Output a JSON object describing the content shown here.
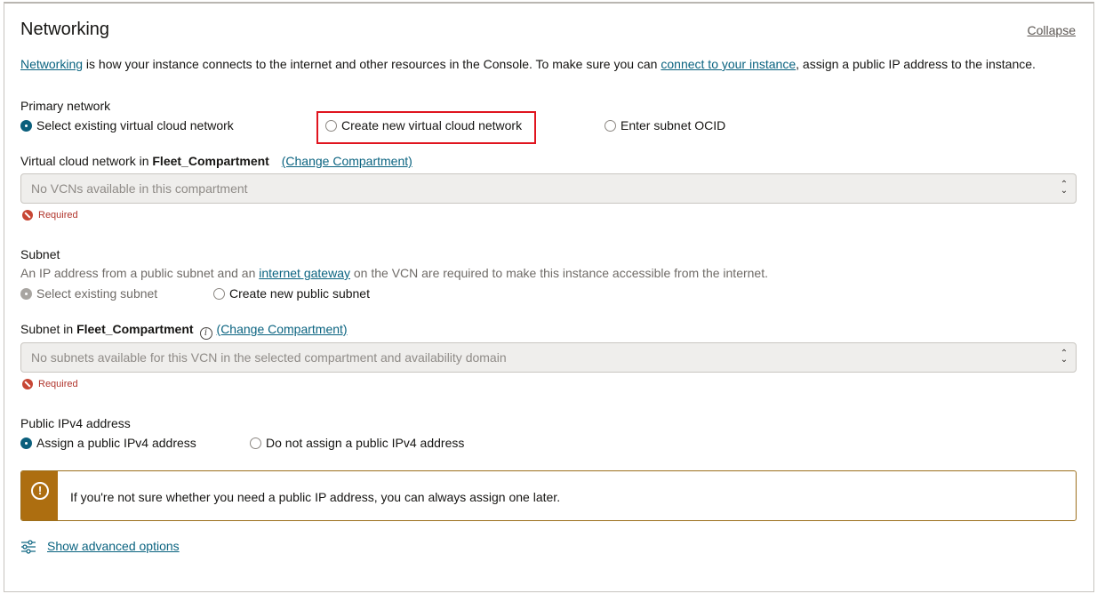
{
  "section": {
    "title": "Networking",
    "collapse_label": "Collapse"
  },
  "intro": {
    "link1": "Networking",
    "text1": " is how your instance connects to the internet and other resources in the Console. To make sure you can ",
    "link2": "connect to your instance",
    "text2": ", assign a public IP address to the instance."
  },
  "primary_network": {
    "label": "Primary network",
    "options": [
      {
        "label": "Select existing virtual cloud network",
        "selected": true
      },
      {
        "label": "Create new virtual cloud network",
        "selected": false
      },
      {
        "label": "Enter subnet OCID",
        "selected": false
      }
    ]
  },
  "vcn": {
    "label": "Virtual cloud network in ",
    "compartment": "Fleet_Compartment",
    "change_label": "(Change Compartment)",
    "placeholder": "No VCNs available in this compartment",
    "required": "Required"
  },
  "subnet": {
    "label": "Subnet",
    "desc1": "An IP address from a public subnet and an ",
    "desc_link": "internet gateway",
    "desc2": " on the VCN are required to make this instance accessible from the internet.",
    "options": [
      {
        "label": "Select existing subnet",
        "selected": true,
        "disabled": true
      },
      {
        "label": "Create new public subnet",
        "selected": false
      }
    ]
  },
  "subnet_select": {
    "label": "Subnet in ",
    "compartment": "Fleet_Compartment",
    "change_label": "(Change Compartment)",
    "placeholder": "No subnets available for this VCN in the selected compartment and availability domain",
    "required": "Required"
  },
  "public_ip": {
    "label": "Public IPv4 address",
    "options": [
      {
        "label": "Assign a public IPv4 address",
        "selected": true
      },
      {
        "label": "Do not assign a public IPv4 address",
        "selected": false
      }
    ]
  },
  "banner": {
    "icon": "!",
    "text": "If you're not sure whether you need a public IP address, you can always assign one later."
  },
  "advanced": {
    "label": "Show advanced options"
  },
  "colors": {
    "link": "#0a6380",
    "radio_selected": "#0a5f7c",
    "error": "#c74634",
    "warning": "#ad6e10",
    "highlight": "#e0141e"
  }
}
